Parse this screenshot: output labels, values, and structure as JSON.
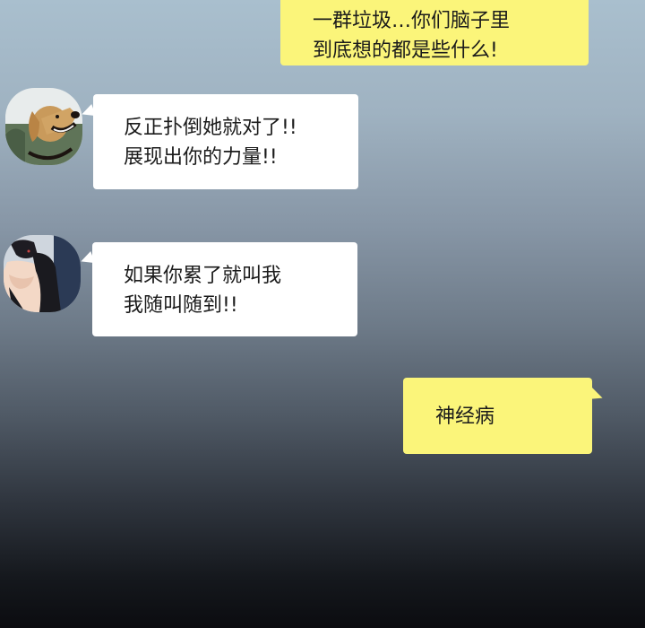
{
  "messages": [
    {
      "sender": "other",
      "bubble_color": "#fbf57a",
      "lines": [
        "一群垃圾…你们脑子里",
        "到底想的都是些什么!"
      ]
    },
    {
      "sender": "dog",
      "avatar_icon": "dog-avatar-icon",
      "bubble_color": "#ffffff",
      "lines": [
        "反正扑倒她就对了!!",
        "展现出你的力量!!"
      ]
    },
    {
      "sender": "woman",
      "avatar_icon": "woman-avatar-icon",
      "bubble_color": "#ffffff",
      "lines": [
        "如果你累了就叫我",
        "我随叫随到!!"
      ]
    },
    {
      "sender": "me",
      "bubble_color": "#fbf57a",
      "lines": [
        "神经病"
      ]
    }
  ]
}
